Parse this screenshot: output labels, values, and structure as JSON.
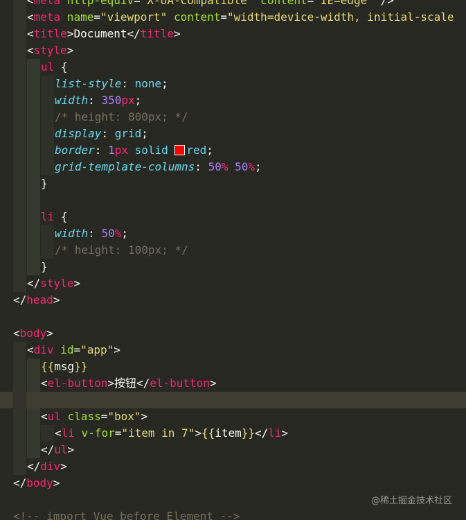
{
  "editor": {
    "lines": {
      "l01": {
        "a": "<",
        "b": "meta",
        "c": " http-equiv",
        "d": "=",
        "e": "\"X-UA-Compatible\"",
        "f": " content",
        "g": "=",
        "h": "\"IE=edge\"",
        "i": " />"
      },
      "l02": {
        "a": "<",
        "b": "meta",
        "c": " name",
        "d": "=",
        "e": "\"viewport\"",
        "f": " content",
        "g": "=",
        "h": "\"width=device-width, initial-scale"
      },
      "l03": {
        "a": "<",
        "b": "title",
        "c": ">Document</",
        "d": "title",
        "e": ">"
      },
      "l04": {
        "a": "<",
        "b": "style",
        "c": ">"
      },
      "l05": {
        "a": "ul",
        "b": " {"
      },
      "l06": {
        "a": "list-style",
        "b": ": ",
        "c": "none",
        "d": ";"
      },
      "l07": {
        "a": "width",
        "b": ": ",
        "c": "350",
        "d": "px",
        "e": ";"
      },
      "l08": {
        "a": "/* height: 800px; */"
      },
      "l09": {
        "a": "display",
        "b": ": ",
        "c": "grid",
        "d": ";"
      },
      "l10": {
        "a": "border",
        "b": ": ",
        "c": "1",
        "d": "px",
        "e": " solid ",
        "f": "red",
        "g": ";"
      },
      "l11": {
        "a": "grid-template-columns",
        "b": ": ",
        "c": "50",
        "d": "%",
        "e": " ",
        "f": "50",
        "g": "%",
        "h": ";"
      },
      "l12": {
        "a": "}"
      },
      "l13": {
        "a": "li",
        "b": " {"
      },
      "l14": {
        "a": "width",
        "b": ": ",
        "c": "50",
        "d": "%",
        "e": ";"
      },
      "l15": {
        "a": "/* height: 100px; */"
      },
      "l16": {
        "a": "}"
      },
      "l17": {
        "a": "</",
        "b": "style",
        "c": ">"
      },
      "l18": {
        "a": "</",
        "b": "head",
        "c": ">"
      },
      "l19": {
        "a": "<",
        "b": "body",
        "c": ">"
      },
      "l20": {
        "a": "<",
        "b": "div",
        "c": " id",
        "d": "=",
        "e": "\"app\"",
        "f": ">"
      },
      "l21": {
        "a": "{{",
        "b": "msg",
        "c": "}}"
      },
      "l22": {
        "a": "<",
        "b": "el-button",
        "c": ">按钮</",
        "d": "el-button",
        "e": ">"
      },
      "l23": {
        "a": "<",
        "b": "ul",
        "c": " class",
        "d": "=",
        "e": "\"box\"",
        "f": ">"
      },
      "l24": {
        "a": "<",
        "b": "li",
        "c": " v-for",
        "d": "=",
        "e": "\"item in 7\"",
        "f": ">",
        "g": "{{",
        "h": "item",
        "i": "}}",
        "j": "</",
        "k": "li",
        "l": ">"
      },
      "l25": {
        "a": "</",
        "b": "ul",
        "c": ">"
      },
      "l26": {
        "a": "</",
        "b": "div",
        "c": ">"
      },
      "l27": {
        "a": "</",
        "b": "body",
        "c": ">"
      },
      "l28": {
        "a": "<!-- import Vue before Element -->"
      }
    },
    "watermark": "@稀土掘金技术社区",
    "colors": {
      "background": "#272822",
      "tag": "#f92672",
      "attribute": "#a6e22e",
      "string": "#e6db74",
      "property": "#66d9ef",
      "number": "#ae81ff",
      "comment": "#75715e",
      "highlight_line": "#3e3d32",
      "red_swatch": "#ff0000"
    }
  }
}
